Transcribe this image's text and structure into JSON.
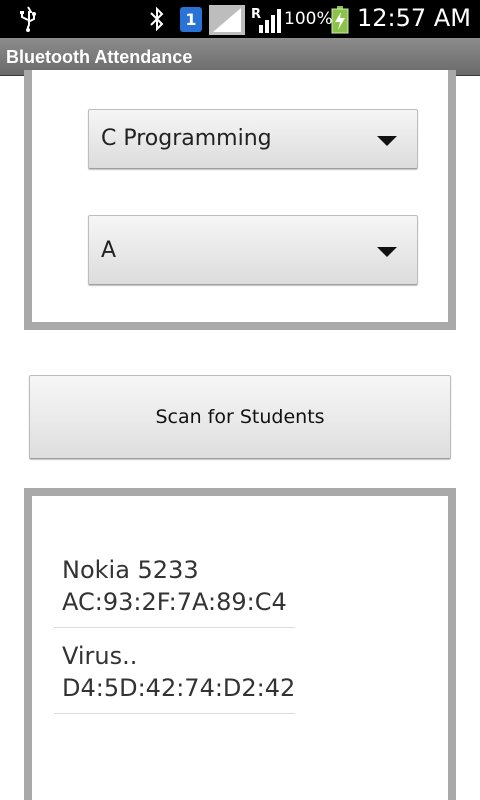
{
  "status_bar": {
    "sim_slot": "1",
    "network_roaming": "R",
    "battery_percent": "100%",
    "time": "12:57 AM",
    "icons": [
      "usb-icon",
      "bluetooth-icon",
      "sim-icon",
      "signal-icon",
      "roaming-signal-icon",
      "battery-charging-icon"
    ]
  },
  "app": {
    "title": "Bluetooth Attendance"
  },
  "form": {
    "subject_selected": "C Programming",
    "section_selected": "A"
  },
  "actions": {
    "scan_label": "Scan for Students"
  },
  "devices": [
    {
      "name": "Nokia 5233",
      "address": "AC:93:2F:7A:89:C4"
    },
    {
      "name": "Virus..",
      "address": "D4:5D:42:74:D2:42"
    }
  ],
  "colors": {
    "status_bar_bg": "#000000",
    "title_bar_bg": "#7a7a7a",
    "frame_border": "#a9a9a9",
    "sim_badge": "#2a73d6",
    "battery_charge": "#8bc34a"
  }
}
